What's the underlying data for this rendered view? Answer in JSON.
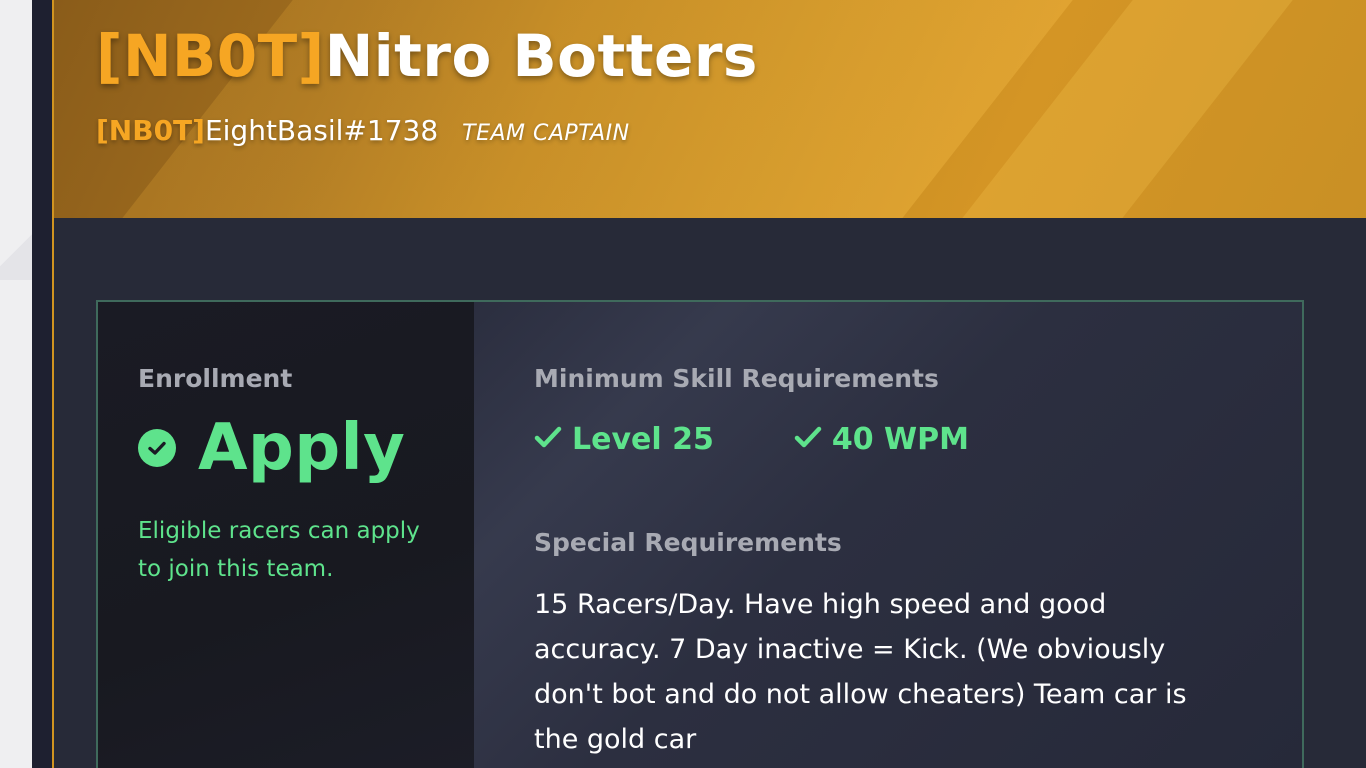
{
  "team": {
    "tag": "[NB0T]",
    "name": "Nitro Botters"
  },
  "captain": {
    "tag": "[NB0T]",
    "username": "EightBasil#1738",
    "role": "TEAM CAPTAIN"
  },
  "enrollment": {
    "label": "Enrollment",
    "status": "Apply",
    "description": "Eligible racers can apply to join this team."
  },
  "requirements": {
    "minimum_label": "Minimum Skill Requirements",
    "skills": [
      {
        "label": "Level 25",
        "icon": "check-icon"
      },
      {
        "label": "40 WPM",
        "icon": "check-icon"
      }
    ],
    "special_label": "Special Requirements",
    "special_text": "15 Racers/Day. Have high speed and good accuracy. 7 Day inactive = Kick. (We obviously don't bot and do not allow cheaters) Team car is the gold car"
  },
  "colors": {
    "accent_gold": "#f6a623",
    "accent_green": "#5ee38c",
    "panel_border": "#3f6a5c",
    "background": "#272a38"
  }
}
